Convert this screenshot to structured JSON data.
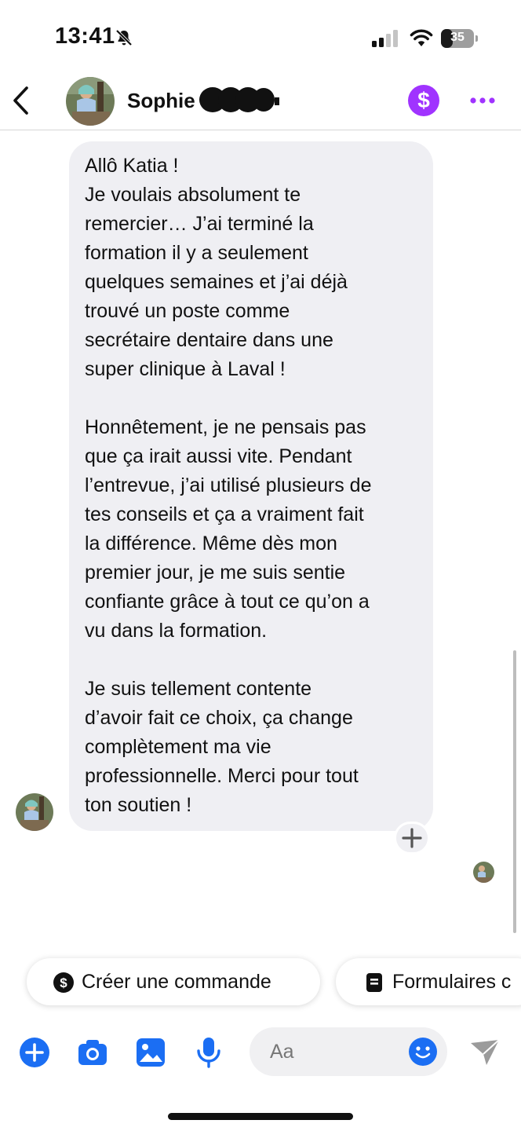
{
  "status_bar": {
    "time": "13:41",
    "battery_level": "35",
    "battery_fraction": 0.35
  },
  "header": {
    "contact_name": "Sophie",
    "payment_symbol": "$",
    "back_icon": "chevron-left-icon",
    "more_icon": "more-dots-icon"
  },
  "message": {
    "lines": [
      "Allô Katia !",
      "Je voulais absolument te",
      "remercier… J’ai terminé la",
      "formation il y a seulement",
      "quelques semaines et j’ai déjà",
      "trouvé un poste comme",
      "secrétaire dentaire dans une",
      "super clinique à Laval !",
      "",
      "Honnêtement, je ne pensais pas",
      "que ça irait aussi vite. Pendant",
      "l’entrevue, j’ai utilisé plusieurs de",
      "tes conseils et ça a vraiment fait",
      "la différence. Même dès mon",
      "premier jour, je me suis sentie",
      "confiante grâce à tout ce qu’on a",
      "vu dans la formation.",
      "",
      "Je suis tellement contente",
      "d’avoir fait ce choix, ça change",
      "complètement ma vie",
      "professionnelle. Merci pour tout",
      "ton soutien !"
    ]
  },
  "quick_actions": [
    {
      "label": "Créer une commande",
      "icon": "dollar-circle-icon"
    },
    {
      "label": "Formulaires c",
      "icon": "document-icon"
    }
  ],
  "composer": {
    "placeholder": "Aa",
    "icons": [
      "plus-icon",
      "camera-icon",
      "gallery-icon",
      "microphone-icon",
      "emoji-icon",
      "send-icon"
    ]
  },
  "colors": {
    "accent": "#1b6ef3",
    "payment": "#a033ff",
    "bubble": "#efeff3"
  }
}
